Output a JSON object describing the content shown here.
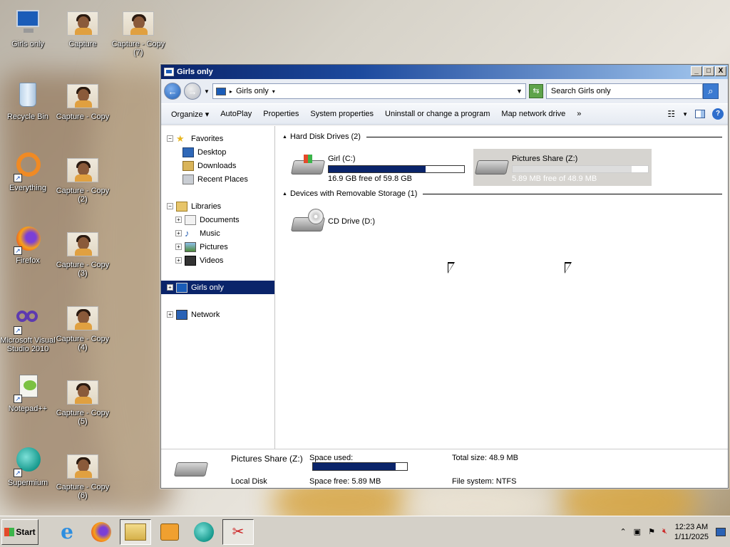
{
  "desktop": {
    "icons": [
      {
        "label": "Girls only",
        "icon": "computer-icon"
      },
      {
        "label": "Recycle Bin",
        "icon": "recycle-bin-icon"
      },
      {
        "label": "Everything",
        "icon": "everything-icon"
      },
      {
        "label": "Firefox",
        "icon": "firefox-icon"
      },
      {
        "label": "Microsoft Visual Studio 2010",
        "icon": "visual-studio-icon"
      },
      {
        "label": "Notepad++",
        "icon": "notepadpp-icon"
      },
      {
        "label": "Supermium",
        "icon": "supermium-icon"
      },
      {
        "label": "Capture",
        "icon": "image-file-icon"
      },
      {
        "label": "Capture - Copy",
        "icon": "image-file-icon"
      },
      {
        "label": "Capture - Copy (2)",
        "icon": "image-file-icon"
      },
      {
        "label": "Capture - Copy (3)",
        "icon": "image-file-icon"
      },
      {
        "label": "Capture - Copy (4)",
        "icon": "image-file-icon"
      },
      {
        "label": "Capture - Copy (5)",
        "icon": "image-file-icon"
      },
      {
        "label": "Capture - Copy (6)",
        "icon": "image-file-icon"
      },
      {
        "label": "Capture - Copy (7)",
        "icon": "image-file-icon"
      }
    ]
  },
  "window": {
    "title": "Girls only",
    "controls": {
      "minimize": "_",
      "maximize": "□",
      "close": "X"
    },
    "address": {
      "crumb": "Girls only"
    },
    "search": {
      "placeholder": "Search Girls only"
    },
    "commands": [
      "Organize ▾",
      "AutoPlay",
      "Properties",
      "System properties",
      "Uninstall or change a program",
      "Map network drive",
      "»"
    ],
    "navpane": {
      "favorites": "Favorites",
      "fav_items": [
        "Desktop",
        "Downloads",
        "Recent Places"
      ],
      "libraries": "Libraries",
      "lib_items": [
        "Documents",
        "Music",
        "Pictures",
        "Videos"
      ],
      "computer": "Girls only",
      "network": "Network"
    },
    "groups": {
      "hdd_header": "Hard Disk Drives (2)",
      "removable_header": "Devices with Removable Storage (1)"
    },
    "drives": [
      {
        "name": "Girl  (C:)",
        "free_text": "16.9 GB free of 59.8 GB",
        "used_fraction": 0.717,
        "selected": false
      },
      {
        "name": "Pictures Share (Z:)",
        "free_text": "5.89 MB free of 48.9 MB",
        "used_fraction": 0.88,
        "selected": true
      }
    ],
    "cd_drive": {
      "name": "CD Drive (D:)"
    },
    "details": {
      "name": "Pictures Share (Z:)",
      "type": "Local Disk",
      "space_used_label": "Space used:",
      "space_free_label": "Space free:",
      "space_free": "5.89 MB",
      "total_size_label": "Total size:",
      "total_size": "48.9 MB",
      "filesystem_label": "File system:",
      "filesystem": "NTFS",
      "used_fraction": 0.88
    }
  },
  "taskbar": {
    "start": "Start",
    "apps": [
      "internet-explorer-icon",
      "firefox-icon",
      "explorer-folder-icon",
      "media-player-icon",
      "supermium-icon",
      "snipping-tool-icon"
    ],
    "clock_time": "12:23 AM",
    "clock_date": "1/11/2025"
  }
}
